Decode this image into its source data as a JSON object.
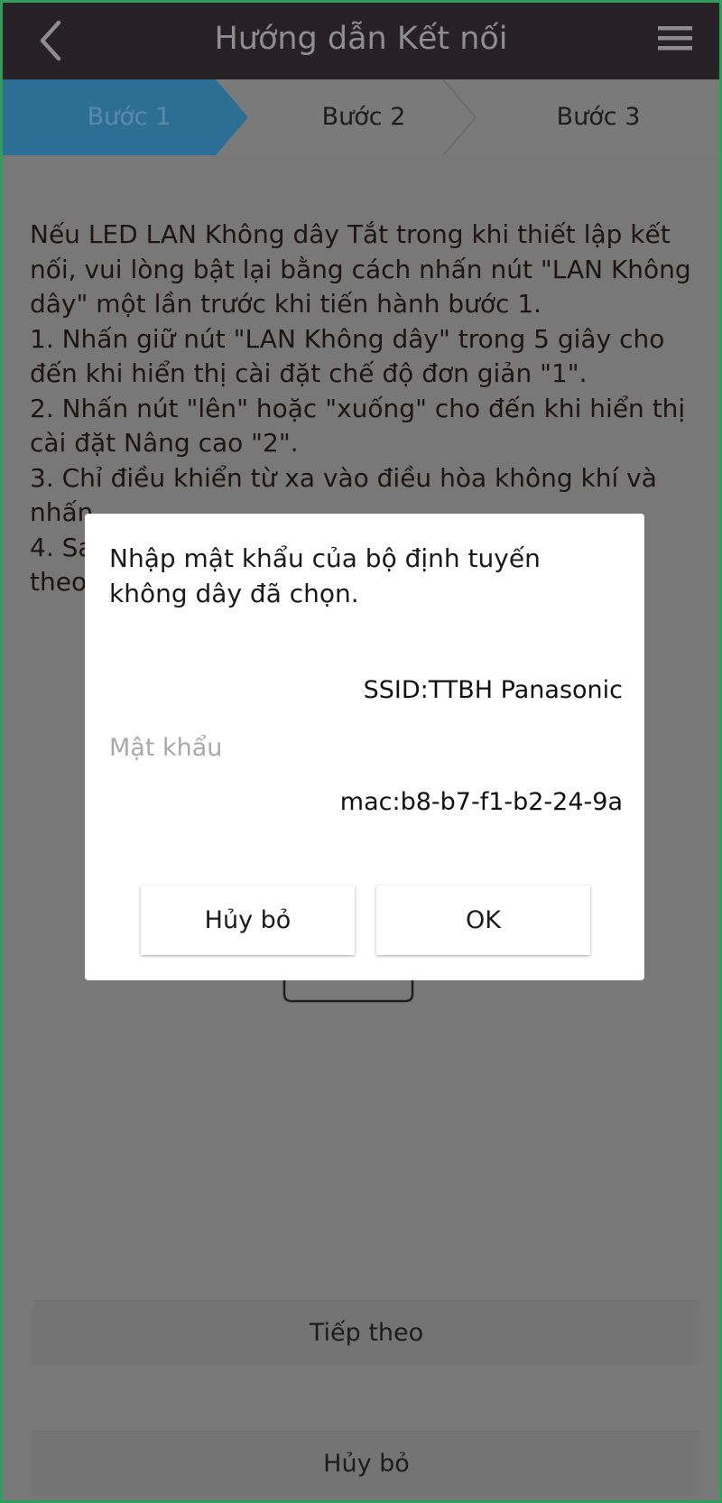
{
  "header": {
    "title": "Hướng dẫn Kết nối",
    "back_icon": "chevron-left-icon",
    "menu_icon": "hamburger-menu-icon"
  },
  "steps": [
    {
      "label": "Bước 1",
      "active": true
    },
    {
      "label": "Bước 2",
      "active": false
    },
    {
      "label": "Bước 3",
      "active": false
    }
  ],
  "instructions": {
    "intro": "Nếu LED LAN Không dây Tắt trong khi thiết lập kết nối, vui lòng bật lại bằng cách nhấn nút \"LAN Không dây\" một lần trước khi tiến hành bước 1.",
    "step1": "1. Nhấn giữ nút \"LAN Không dây\" trong 5 giây cho đến khi hiển thị cài đặt chế độ đơn giản \"1\".",
    "step2": "2. Nhấn nút \"lên\" hoặc \"xuống\" cho đến khi hiển thị cài đặt Nâng cao \"2\".",
    "step3": "3. Chỉ điều khiển từ xa vào điều hòa không khí và nhấn",
    "step4": "4. Sa",
    "step4_cont": "theo"
  },
  "bottom": {
    "next_label": "Tiếp theo",
    "cancel_label": "Hủy bỏ"
  },
  "dialog": {
    "prompt": "Nhập mật khẩu của bộ định tuyến không dây đã chọn.",
    "ssid": "SSID:TTBH Panasonic",
    "password_label": "Mật khẩu",
    "password_value": "mac:b8-b7-f1-b2-24-9a",
    "cancel_label": "Hủy bỏ",
    "ok_label": "OK"
  },
  "colors": {
    "active_step": "#2d6e95",
    "overlay_gray": "#787878",
    "header_bg": "#272024",
    "frame_border": "#2e9e5a"
  }
}
